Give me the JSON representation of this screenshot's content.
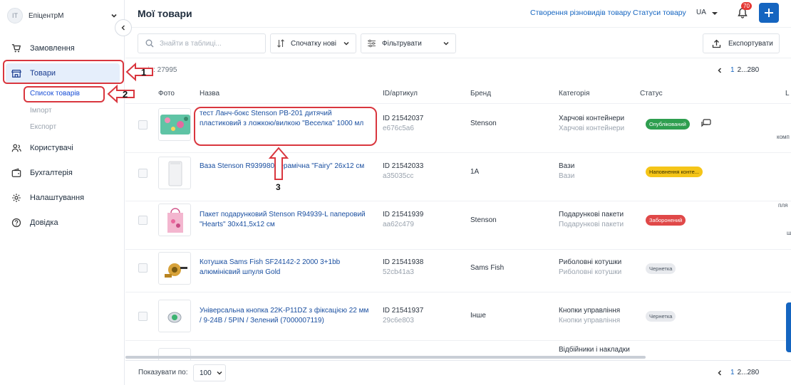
{
  "sidebar": {
    "org_initials": "IT",
    "org_name": "ЕпіцентрМ",
    "items": [
      {
        "label": "Замовлення",
        "icon": "cart-icon"
      },
      {
        "label": "Товари",
        "icon": "store-icon"
      },
      {
        "label": "Користувачі",
        "icon": "users-icon"
      },
      {
        "label": "Бухгалтерія",
        "icon": "wallet-icon"
      },
      {
        "label": "Налаштування",
        "icon": "gear-icon"
      },
      {
        "label": "Довідка",
        "icon": "help-icon"
      }
    ],
    "sub_items": [
      {
        "label": "Список товарів"
      },
      {
        "label": "Імпорт"
      },
      {
        "label": "Експорт"
      }
    ]
  },
  "header": {
    "title": "Мої товари",
    "link1": "Створення різновидів товару",
    "link2": "Статуси товару",
    "lang": "UA",
    "notif_count": "70"
  },
  "toolbar": {
    "search_placeholder": "Знайти в таблиці...",
    "sort_label": "Спочатку нові",
    "filter_label": "Фільтрувати",
    "export_label": "Експортувати"
  },
  "count_text": "рів: 27995",
  "pagination": {
    "current": "1",
    "rest": "2...280"
  },
  "columns": [
    "Фото",
    "Назва",
    "ID/артикул",
    "Бренд",
    "Категорія",
    "Статус",
    "L"
  ],
  "rows": [
    {
      "name": "тест Ланч-бокс Stenson PB-201 дитячий пластиковий з ложкою/вилкою \"Веселка\" 1000 мл",
      "id": "ID 21542037",
      "art": "e676c5a6",
      "brand": "Stenson",
      "cat": "Харчові контейнери",
      "cat_sub": "Харчові контейнери",
      "status": "Опублікований",
      "status_color": "#2e9e4f"
    },
    {
      "name": "Ваза Stenson R939980 керамічна \"Fairy\" 26x12 см",
      "id": "ID 21542033",
      "art": "a35035cc",
      "brand": "1A",
      "cat": "Вази",
      "cat_sub": "Вази",
      "status": "Наповнення конте...",
      "status_color": "#f5c518"
    },
    {
      "name": "Пакет подарунковий Stenson R94939-L паперовий \"Hearts\" 30x41,5x12 см",
      "id": "ID 21541939",
      "art": "aa62c479",
      "brand": "Stenson",
      "cat": "Подарункові пакети",
      "cat_sub": "Подарункові пакети",
      "status": "Заборонений",
      "status_color": "#e04848"
    },
    {
      "name": "Котушка Sams Fish SF24142-2 2000 3+1bb алюмінієвий шпуля Gold",
      "id": "ID 21541938",
      "art": "52cb41a3",
      "brand": "Sams Fish",
      "cat": "Риболовні котушки",
      "cat_sub": "Риболовні котушки",
      "status": "Чернетка",
      "status_color": "#e8eaee"
    },
    {
      "name": "Універсальна кнопка 22K-P11DZ з фіксацією 22 мм / 9-24В / 5PIN / Зелений (7000007119)",
      "id": "ID 21541937",
      "art": "29c6e803",
      "brand": "Інше",
      "cat": "Кнопки управління",
      "cat_sub": "Кнопки управління",
      "status": "Чернетка",
      "status_color": "#e8eaee"
    },
    {
      "cat": "Відбійники і накладки"
    }
  ],
  "edge_texts": [
    "комп",
    "пля",
    "ш"
  ],
  "footer": {
    "per_page_label": "Показувати по:",
    "per_page_value": "100"
  },
  "annotations": [
    "1",
    "2",
    "3"
  ]
}
